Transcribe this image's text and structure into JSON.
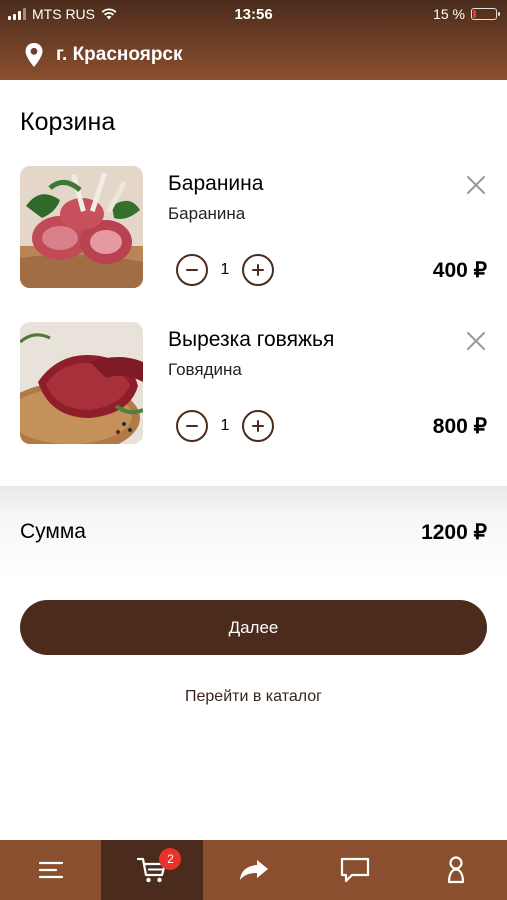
{
  "status_bar": {
    "carrier": "MTS RUS",
    "time": "13:56",
    "battery": "15 %",
    "battery_level": 0.15
  },
  "header": {
    "city": "г. Красноярск",
    "location_icon": "map-pin-icon"
  },
  "page": {
    "title": "Корзина"
  },
  "cart": {
    "items": [
      {
        "name": "Баранина",
        "category": "Баранина",
        "quantity": "1",
        "price": "400 ₽"
      },
      {
        "name": "Вырезка говяжья",
        "category": "Говядина",
        "quantity": "1",
        "price": "800 ₽"
      }
    ]
  },
  "summary": {
    "label": "Сумма",
    "total": "1200 ₽"
  },
  "actions": {
    "next_label": "Далее",
    "catalog_link": "Перейти в каталог"
  },
  "tabbar": {
    "cart_badge": "2",
    "tabs": [
      "menu-icon",
      "cart-icon",
      "share-icon",
      "chat-icon",
      "profile-icon"
    ]
  },
  "colors": {
    "brand_dark": "#4a2b1c",
    "brand": "#8a4f2e",
    "badge": "#e8322a",
    "battery_low": "#e23a2e"
  }
}
